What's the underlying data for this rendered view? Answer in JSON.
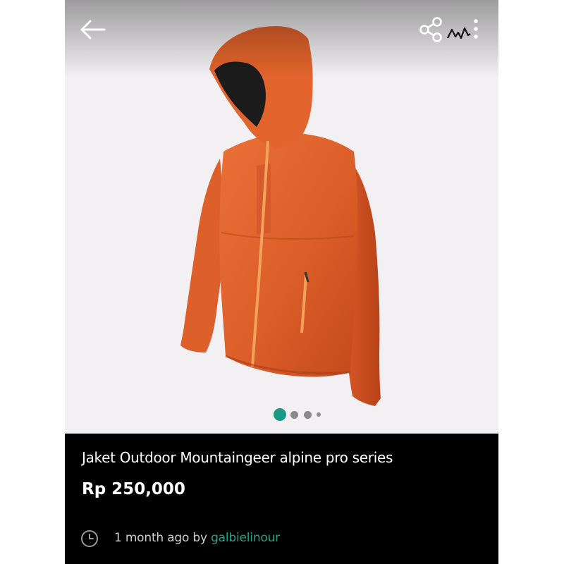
{
  "header": {
    "back_icon": "arrow-left-icon",
    "share_icon": "share-icon",
    "brand_logo": "mountaingeer-logo",
    "more_icon": "more-vertical-icon"
  },
  "gallery": {
    "image_subject": "orange hooded outdoor jacket",
    "total_images": 4,
    "active_index": 0,
    "active_dot_color": "#1a9a86",
    "inactive_dot_color": "#8a8a8a"
  },
  "listing": {
    "title": "Jaket Outdoor Mountaingeer alpine pro series",
    "price": "Rp 250,000",
    "posted_prefix": "1 month ago by ",
    "seller": "galbielinour",
    "clock_icon": "clock-icon"
  },
  "colors": {
    "jacket": "#e0622a",
    "zipper": "#f2a35a",
    "seller_link": "#23a58a",
    "details_background": "#000000"
  }
}
